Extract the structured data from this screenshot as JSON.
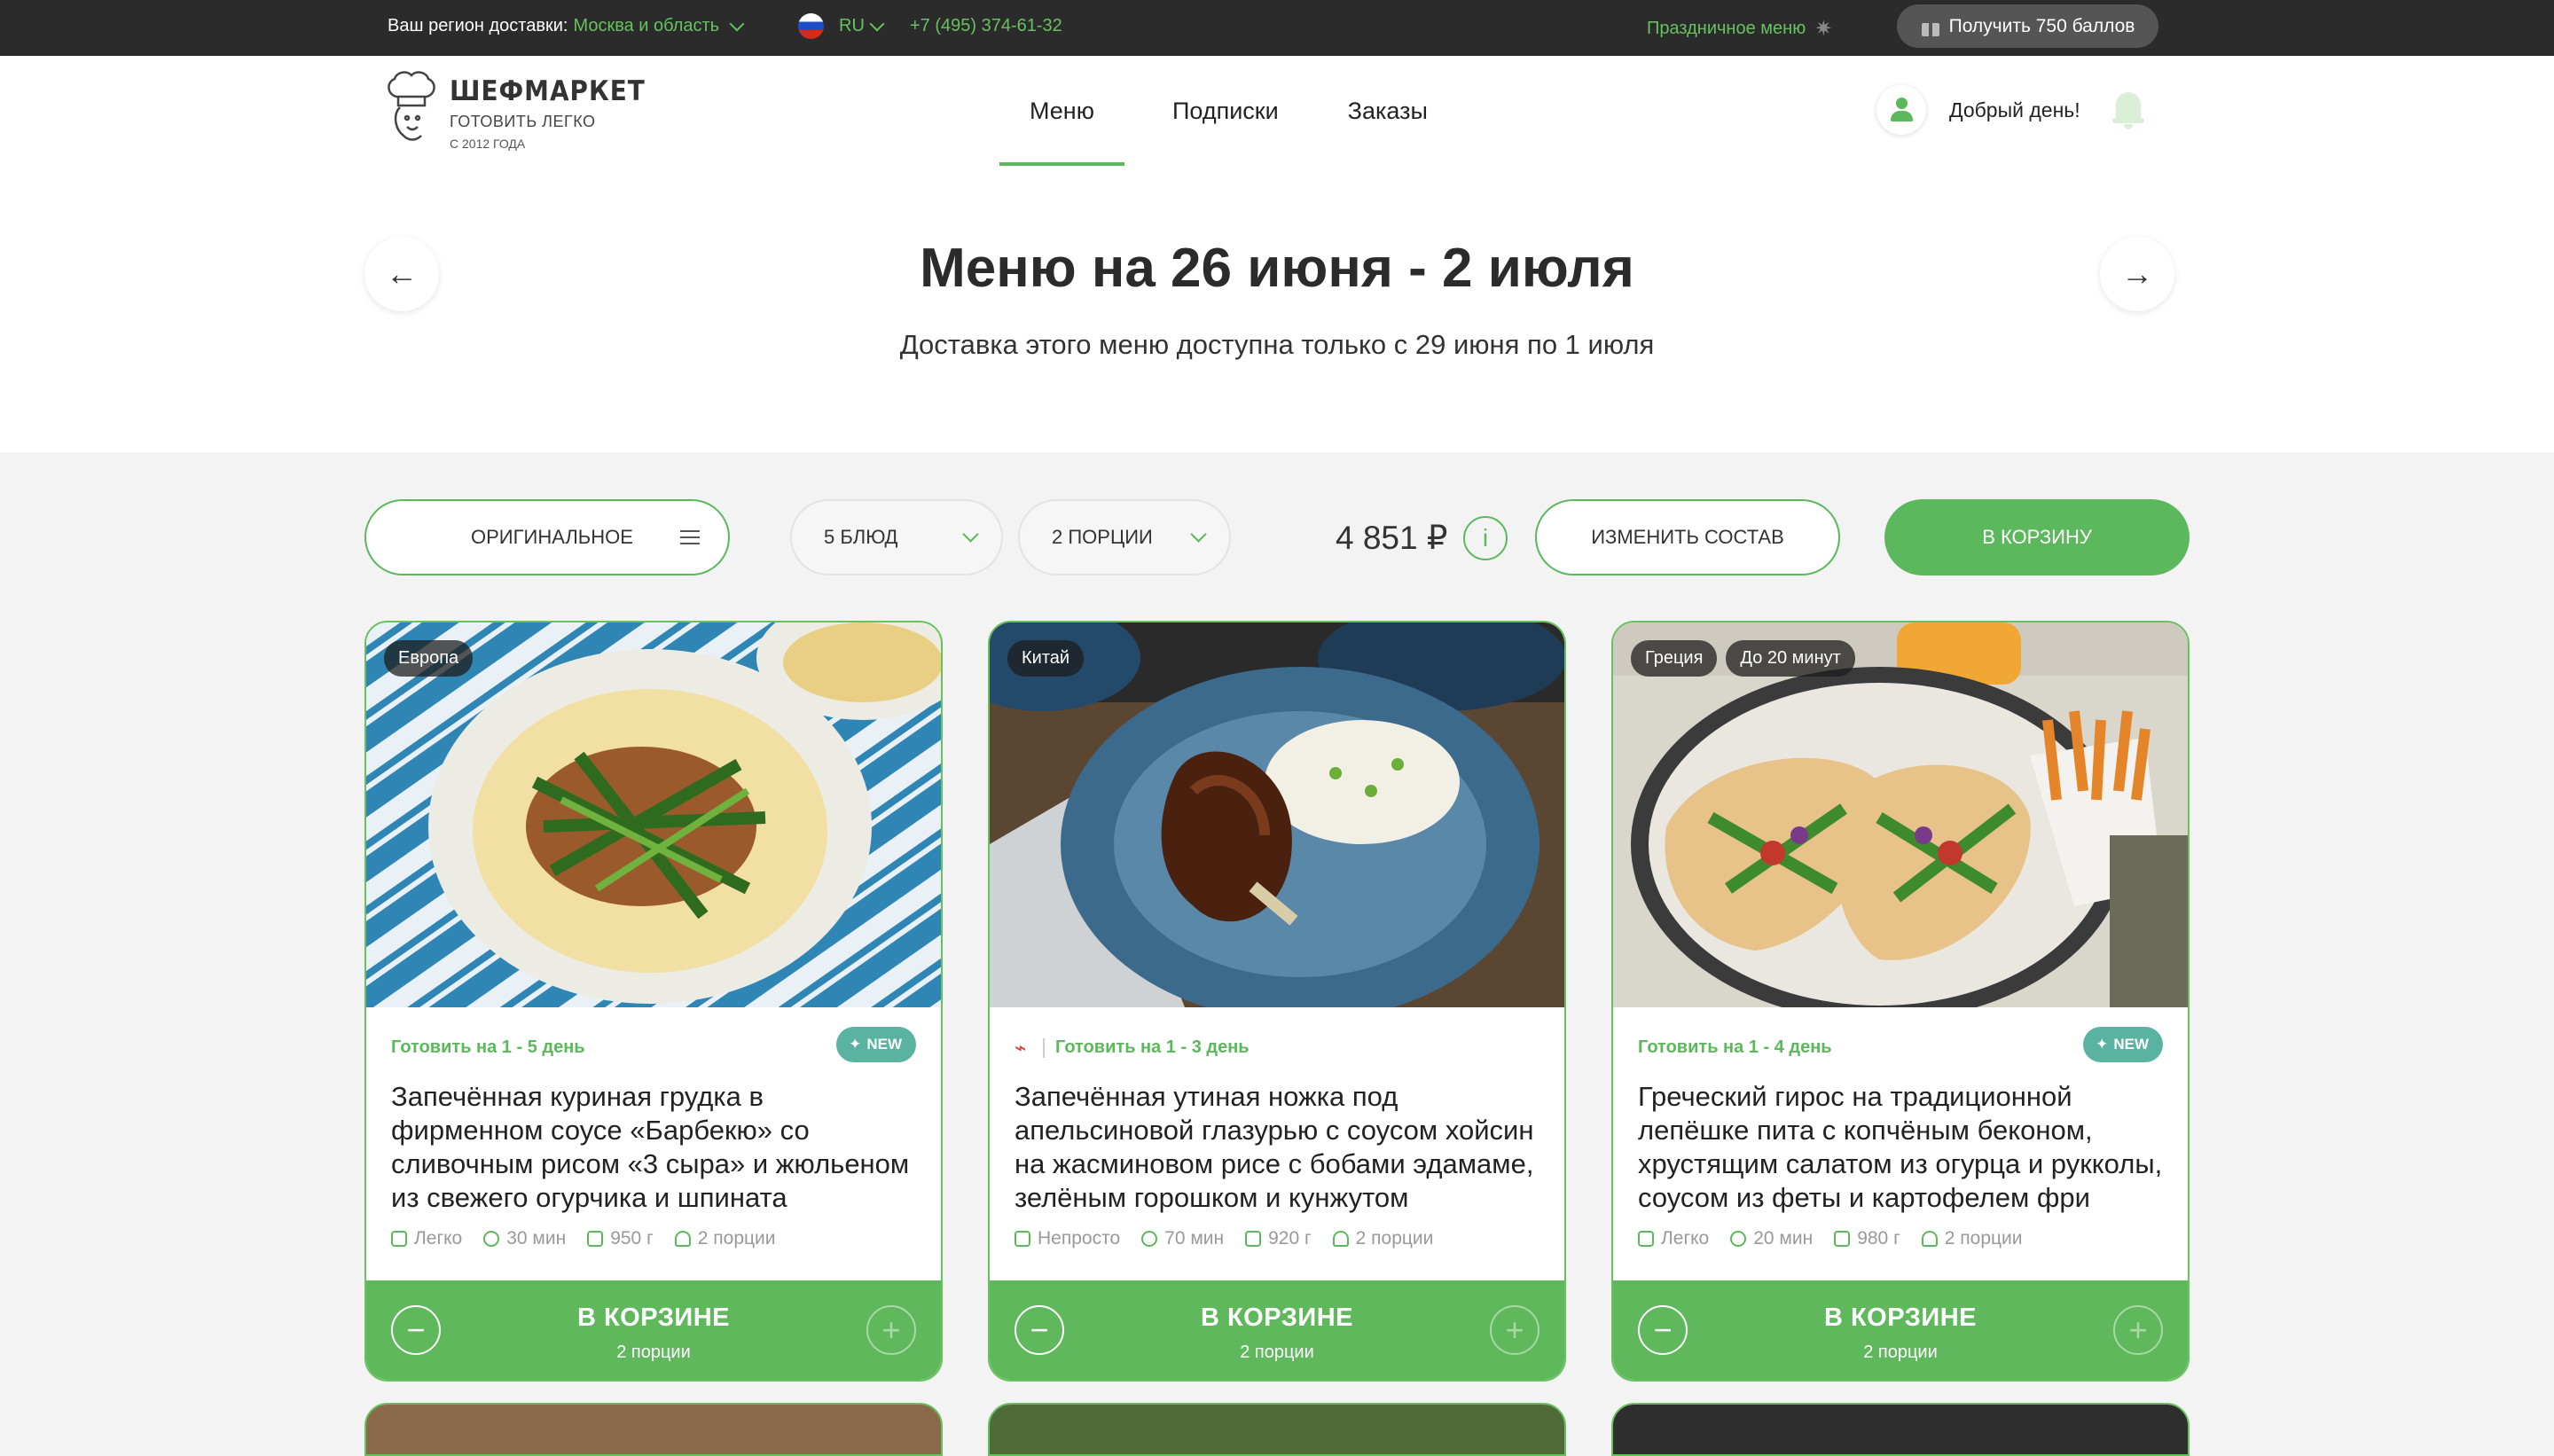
{
  "topbar": {
    "region_label": "Ваш регион доставки:",
    "region_value": "Москва и область",
    "lang": "RU",
    "phone": "+7 (495) 374-61-32",
    "holiday_menu": "Праздничное меню",
    "bonus_button": "Получить 750 баллов"
  },
  "header": {
    "brand": "ШЕФМАРКЕТ",
    "tagline": "ГОТОВИТЬ ЛЕГКО",
    "since": "С 2012 ГОДА",
    "nav": [
      "Меню",
      "Подписки",
      "Заказы"
    ],
    "greeting": "Добрый день!"
  },
  "hero": {
    "title": "Меню на 26 июня - 2 июля",
    "subtitle": "Доставка этого меню доступна только с 29 июня по 1 июля"
  },
  "controls": {
    "menu_type": "ОРИГИНАЛЬНОЕ",
    "dishes": "5 БЛЮД",
    "portions": "2 ПОРЦИИ",
    "price": "4 851 ₽",
    "info": "i",
    "change": "ИЗМЕНИТЬ СОСТАВ",
    "cart": "В КОРЗИНУ"
  },
  "colors": {
    "accent": "#5cb85c",
    "dark": "#2b2b2b",
    "new_badge": "#5ab3a0"
  },
  "cards": [
    {
      "tags": [
        "Европа"
      ],
      "cook_days": "Готовить на 1 - 5 день",
      "new": "NEW",
      "name": "Запечённая куриная грудка в фирменном соусе «Барбекю» со сливочным рисом «3 сыра» и жюльеном из свежего огурчика и шпината",
      "difficulty": "Легко",
      "time": "30 мин",
      "weight": "950 г",
      "portions": "2 порции",
      "in_cart": "В КОРЗИНЕ",
      "cart_portions": "2 порции"
    },
    {
      "tags": [
        "Китай"
      ],
      "cook_days": "Готовить на 1 - 3 день",
      "new": "",
      "name": "Запечённая утиная ножка под апельсиновой глазурью с соусом хойсин на жасминовом рисе с бобами эдамаме, зелёным горошком и кунжутом",
      "difficulty": "Непросто",
      "time": "70 мин",
      "weight": "920 г",
      "portions": "2 порции",
      "in_cart": "В КОРЗИНЕ",
      "cart_portions": "2 порции"
    },
    {
      "tags": [
        "Греция",
        "До 20 минут"
      ],
      "cook_days": "Готовить на 1 - 4 день",
      "new": "NEW",
      "name": "Греческий гирос на традиционной лепёшке пита с копчёным беконом, хрустящим салатом из огурца и рукколы, соусом из феты и картофелем фри",
      "difficulty": "Легко",
      "time": "20 мин",
      "weight": "980 г",
      "portions": "2 порции",
      "in_cart": "В КОРЗИНЕ",
      "cart_portions": "2 порции"
    }
  ]
}
